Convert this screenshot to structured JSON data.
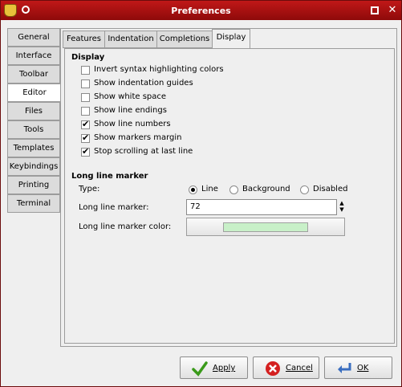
{
  "window": {
    "title": "Preferences"
  },
  "left_tabs": [
    "General",
    "Interface",
    "Toolbar",
    "Editor",
    "Files",
    "Tools",
    "Templates",
    "Keybindings",
    "Printing",
    "Terminal"
  ],
  "top_tabs": [
    "Features",
    "Indentation",
    "Completions",
    "Display"
  ],
  "display": {
    "heading": "Display",
    "options": [
      {
        "label": "Invert syntax highlighting colors",
        "checked": false
      },
      {
        "label": "Show indentation guides",
        "checked": false
      },
      {
        "label": "Show white space",
        "checked": false
      },
      {
        "label": "Show line endings",
        "checked": false
      },
      {
        "label": "Show line numbers",
        "checked": true
      },
      {
        "label": "Show markers margin",
        "checked": true
      },
      {
        "label": "Stop scrolling at last line",
        "checked": true
      }
    ]
  },
  "long_line": {
    "heading": "Long line marker",
    "type_label": "Type:",
    "types": [
      "Line",
      "Background",
      "Disabled"
    ],
    "selected_type": "Line",
    "marker_label": "Long line marker:",
    "marker_value": "72",
    "color_label": "Long line marker color:",
    "color": "#c8f0c8"
  },
  "buttons": {
    "apply": "Apply",
    "cancel": "Cancel",
    "ok": "OK"
  }
}
